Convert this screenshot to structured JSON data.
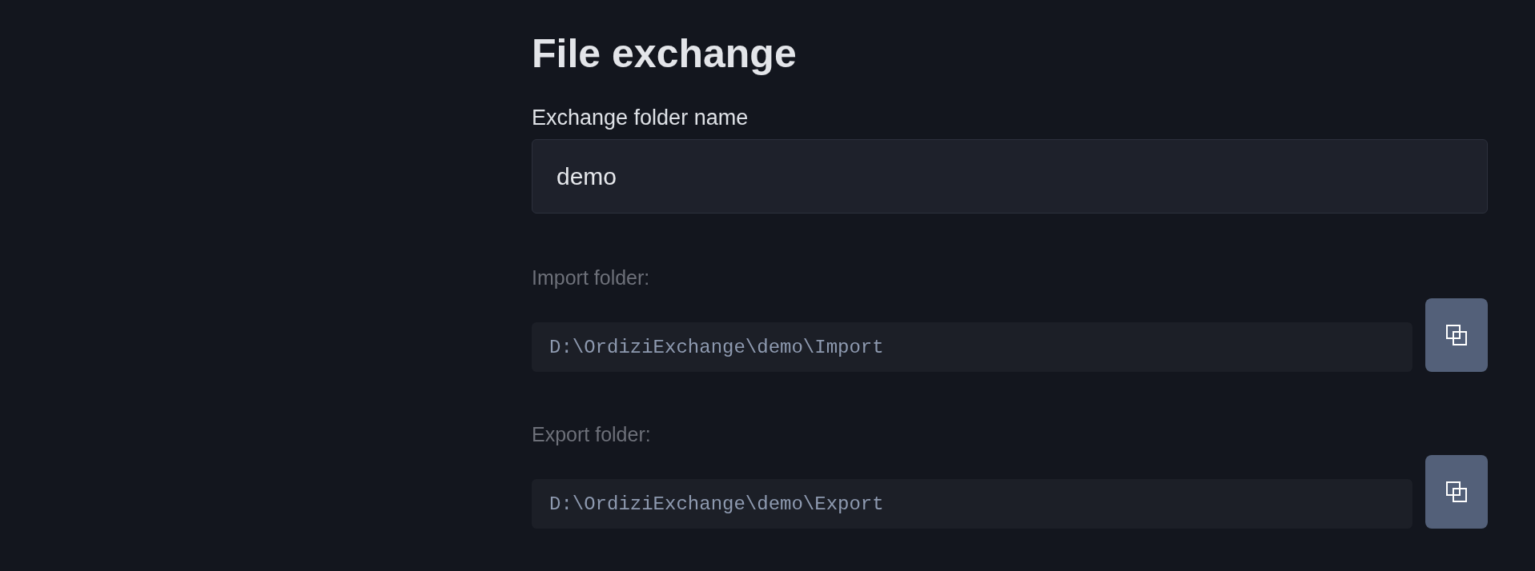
{
  "page": {
    "title": "File exchange"
  },
  "folder_name": {
    "label": "Exchange folder name",
    "value": "demo"
  },
  "folders": [
    {
      "label": "Import folder:",
      "path": "D:\\OrdiziExchange\\demo\\Import"
    },
    {
      "label": "Export folder:",
      "path": "D:\\OrdiziExchange\\demo\\Export"
    }
  ]
}
